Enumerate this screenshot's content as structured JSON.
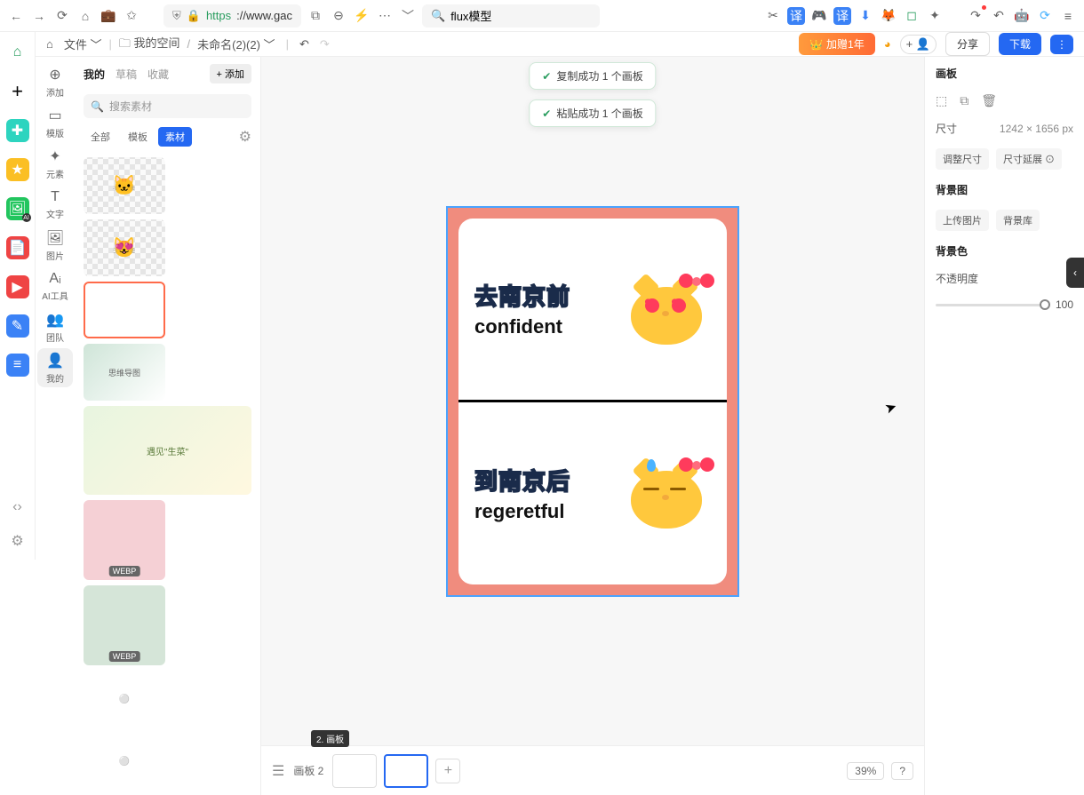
{
  "browser": {
    "url_scheme": "https",
    "url_host": "://www.gac",
    "search_value": "flux模型",
    "search_placeholder": ""
  },
  "topbar": {
    "file": "文件",
    "workspace_prefix": "我的空间",
    "doc_name": "未命名(2)(2)",
    "upgrade": "加赠1年",
    "share": "分享",
    "download": "下载"
  },
  "side_tools": [
    {
      "label": "添加",
      "icon": "⊕"
    },
    {
      "label": "模版",
      "icon": "▭"
    },
    {
      "label": "元素",
      "icon": "✦"
    },
    {
      "label": "文字",
      "icon": "T"
    },
    {
      "label": "图片",
      "icon": "🖼"
    },
    {
      "label": "AI工具",
      "icon": "Aᵢ"
    },
    {
      "label": "团队",
      "icon": "👥"
    },
    {
      "label": "我的",
      "icon": "👤"
    }
  ],
  "asset_panel": {
    "tabs": [
      "我的",
      "草稿",
      "收藏"
    ],
    "active_tab": "我的",
    "add": "+ 添加",
    "search_placeholder": "搜索素材",
    "chips": [
      "全部",
      "模板",
      "素材"
    ],
    "active_chip": "素材",
    "webp_badge": "WEBP"
  },
  "canvas": {
    "toast1": "复制成功 1 个画板",
    "toast2": "粘贴成功 1 个画板",
    "top": {
      "cn": "去南京前",
      "en": "confident"
    },
    "bottom": {
      "cn": "到南京后",
      "en": "regeretful"
    }
  },
  "pages": {
    "label_prefix": "画板 2",
    "tooltip": "2. 画板",
    "zoom": "39%",
    "help": "?"
  },
  "right": {
    "panel": "画板",
    "size_label": "尺寸",
    "size_value": "1242 × 1656 px",
    "adjust": "调整尺寸",
    "extend": "尺寸延展 ⊙",
    "bg_label": "背景图",
    "upload": "上传图片",
    "library": "背景库",
    "bg_color": "背景色",
    "opacity": "不透明度",
    "opacity_value": "100"
  }
}
